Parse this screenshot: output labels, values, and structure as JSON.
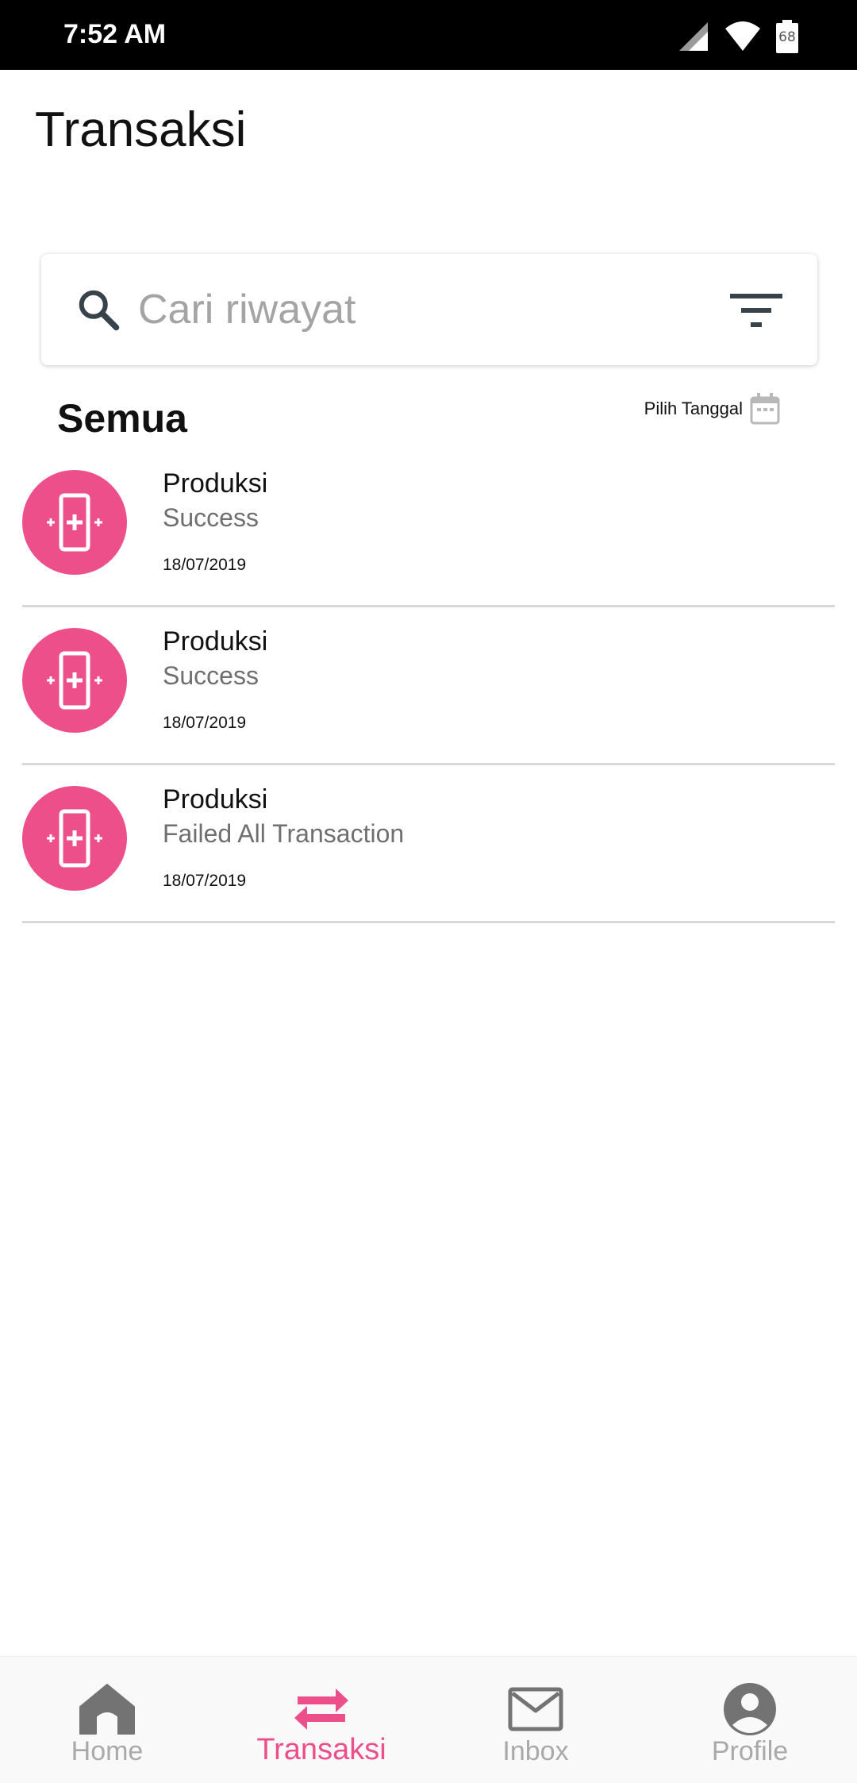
{
  "status_bar": {
    "time": "7:52 AM",
    "battery": "68",
    "icons": [
      "signal-icon",
      "wifi-icon",
      "battery-icon"
    ]
  },
  "header": {
    "title": "Transaksi"
  },
  "search": {
    "placeholder": "Cari riwayat",
    "value": "",
    "icon": "search-icon",
    "filter_icon": "filter-icon"
  },
  "section": {
    "title": "Semua",
    "date_picker_label": "Pilih Tanggal",
    "date_picker_icon": "calendar-icon"
  },
  "transactions": [
    {
      "title": "Produksi",
      "status": "Success",
      "date": "18/07/2019",
      "icon": "phone-plus-icon"
    },
    {
      "title": "Produksi",
      "status": "Success",
      "date": "18/07/2019",
      "icon": "phone-plus-icon"
    },
    {
      "title": "Produksi",
      "status": "Failed All Transaction",
      "date": "18/07/2019",
      "icon": "phone-plus-icon"
    }
  ],
  "bottom_nav": {
    "items": [
      {
        "label": "Home",
        "icon": "home-icon",
        "active": false
      },
      {
        "label": "Transaksi",
        "icon": "swap-arrows-icon",
        "active": true
      },
      {
        "label": "Inbox",
        "icon": "mail-icon",
        "active": false
      },
      {
        "label": "Profile",
        "icon": "profile-icon",
        "active": false
      }
    ]
  },
  "colors": {
    "accent": "#ec4f8a",
    "status_bar": "#000000",
    "nav_inactive": "#a9a9a9",
    "divider": "#d8d8d8"
  }
}
